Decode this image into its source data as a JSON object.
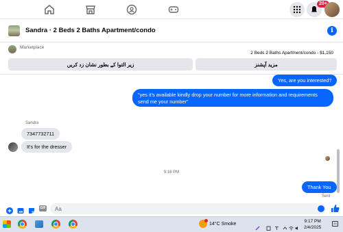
{
  "nav": {
    "icons": [
      "home-icon",
      "marketplace-icon",
      "groups-icon",
      "gaming-icon",
      "menu-grid-icon",
      "notifications-icon",
      "messenger-icon"
    ],
    "notification_badge": "20+"
  },
  "chat": {
    "title": "Sandra · 2 Beds 2 Baths Apartment/condo"
  },
  "marketplace": {
    "label": "Marketplace",
    "listing": "2 Beds 2 Baths Apartment/condo - $1,150",
    "mark_pending_label": "زیر التوا کے بطور نشان زد کریں",
    "more_options_label": "مزید آپشنز"
  },
  "messages": {
    "outgoing_1": "Yes, are you interested?",
    "outgoing_2": "\"yes it's available kindly drop your number for more information and requirements send me your number\"",
    "sender_name": "Sandra",
    "incoming_1": "7347732711",
    "incoming_2": "It's for the dresser",
    "timestamp": "9:16 PM",
    "outgoing_3": "Thank You",
    "sent_status": "Sent"
  },
  "composer": {
    "placeholder": "Aa",
    "gif_label": "GIF"
  },
  "taskbar": {
    "weather": "14°C  Smoke",
    "time": "9:17 PM",
    "date": "2/4/2025",
    "notif_count": "24"
  },
  "colors": {
    "accent": "#0866ff",
    "badge": "#e41e3f",
    "bubble_in": "#e4e6eb"
  }
}
